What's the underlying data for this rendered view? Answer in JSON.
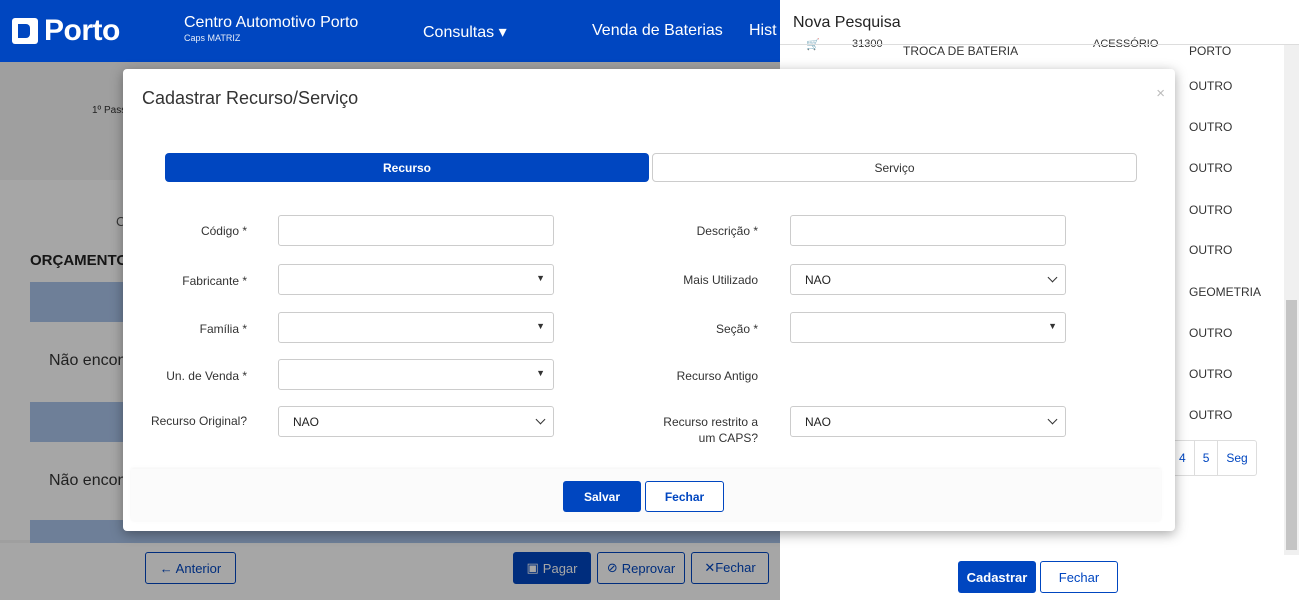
{
  "header": {
    "logo": "Porto",
    "brand_title": "Centro Automotivo Porto",
    "brand_sub": "Caps MATRIZ",
    "nav": [
      "Consultas ▾",
      "Venda de Baterias",
      "Hist"
    ]
  },
  "background": {
    "step": "1º Pass",
    "c_letter": "C",
    "orcamento": "ORÇAMENTO",
    "not_found_1": "Não encon",
    "not_found_2": "Não encon",
    "buttons": {
      "anterior": "← Anterior",
      "pagar": "Pagar",
      "reprovar": "Reprovar",
      "fechar": "✕Fechar"
    }
  },
  "side_panel": {
    "title": "Nova Pesquisa",
    "row_top": {
      "code": "31300",
      "desc": "TROCA DE BATERIA",
      "type": "ACESSÓRIO",
      "cat": "PORTO"
    },
    "categories": [
      "OUTRO",
      "OUTRO",
      "OUTRO",
      "OUTRO",
      "OUTRO",
      "GEOMETRIA",
      "OUTRO",
      "OUTRO",
      "OUTRO"
    ],
    "pager": [
      "4",
      "5",
      "Seg"
    ],
    "cadastrar": "Cadastrar",
    "fechar": "Fechar"
  },
  "modal": {
    "title": "Cadastrar Recurso/Serviço",
    "close": "×",
    "tabs": {
      "recurso": "Recurso",
      "servico": "Serviço"
    },
    "fields": {
      "codigo": "Código *",
      "fabricante": "Fabricante *",
      "familia": "Família *",
      "un_venda": "Un. de Venda *",
      "recurso_original": "Recurso Original?",
      "recurso_original_value": "NAO",
      "descricao": "Descrição *",
      "mais_utilizado": "Mais Utilizado",
      "mais_utilizado_value": "NAO",
      "secao": "Seção *",
      "recurso_antigo": "Recurso Antigo",
      "recurso_restrito": "Recurso restrito a um CAPS?",
      "recurso_restrito_value": "NAO"
    },
    "buttons": {
      "salvar": "Salvar",
      "fechar": "Fechar"
    }
  },
  "colors": {
    "primary": "#0046c0"
  }
}
